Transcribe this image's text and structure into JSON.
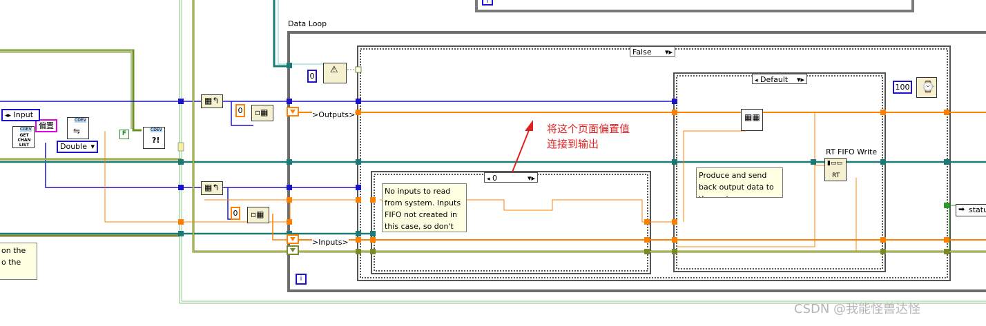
{
  "diagram": {
    "loop_label": "Data Loop",
    "case_outer_selector": "False",
    "case_inner_selector": "Default",
    "case_inputs_selector": "0",
    "input_enum": "Input",
    "type_enum": "Double",
    "pink_constant": "偏置",
    "bool_constant": "F",
    "zero_constant_1": "0",
    "zero_constant_2": "0",
    "zero_constant_3": "0",
    "timer_constant": "100",
    "outputs_tunnel": ">Outputs>",
    "inputs_tunnel": ">Inputs>",
    "rt_fifo_label": "RT FIFO Write",
    "rt_fifo_node_text": "RT",
    "get_chan_list_text": "GET CHAN LIST",
    "cdev_tag": "CDEV",
    "status_label": "statu",
    "iteration_label": "i",
    "comment_no_inputs": "No inputs to read from system. Inputs FIFO not created in this case, so don't",
    "comment_produce": "Produce and send back output data to the system",
    "comment_left_line1": "on the",
    "comment_left_line2": "o the",
    "annotation_line1": "将这个页面偏置值",
    "annotation_line2": "连接到输出",
    "watermark": "CSDN @我能怪兽达怪"
  },
  "colors": {
    "orange_wire": "#ff8000",
    "blue_wire": "#1c14cc",
    "teal_wire": "#1a7a74",
    "green_wire": "#7a9a2a",
    "structure_gray": "#6d6d6d",
    "annotation_red": "#e02020"
  }
}
